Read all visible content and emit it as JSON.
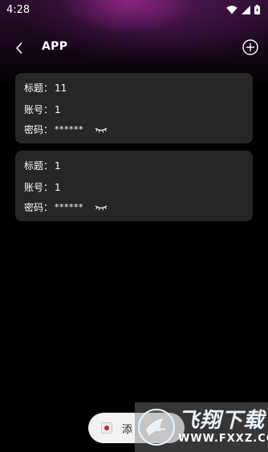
{
  "status_bar": {
    "time": "4:28"
  },
  "app_bar": {
    "title": "APP",
    "back_icon": "chevron-left-icon",
    "add_icon": "plus-circle-icon"
  },
  "entries": [
    {
      "title_label": "标题：",
      "title_value": "11",
      "account_label": "账号：",
      "account_value": "1",
      "password_label": "密码：",
      "password_value": "******",
      "eye_icon": "eye-closed-icon"
    },
    {
      "title_label": "标题：",
      "title_value": "1",
      "account_label": "账号：",
      "account_value": "1",
      "password_label": "密码：",
      "password_value": "******",
      "eye_icon": "eye-closed-icon"
    }
  ],
  "toast": {
    "text": "添"
  },
  "watermark": {
    "name": "飞翔下载",
    "url": "WWW.FXXZ.COM"
  },
  "colors": {
    "background": "#000000",
    "card": "#262626",
    "header_accent": "#6a1f6c"
  }
}
